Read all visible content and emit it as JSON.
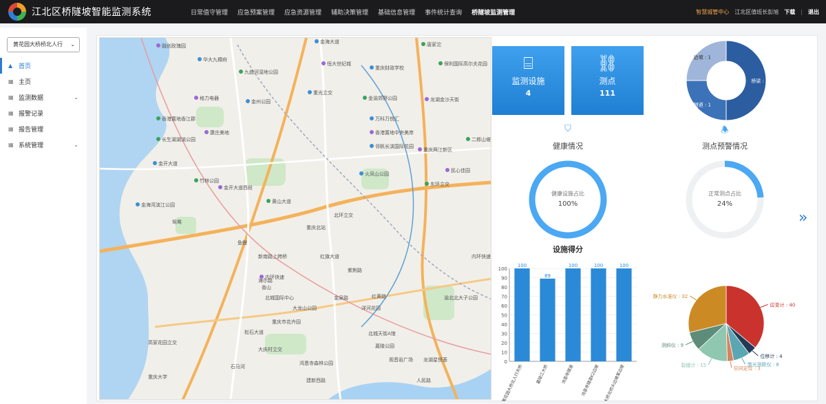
{
  "app": {
    "title": "江北区桥隧坡智能监测系统"
  },
  "nav": [
    "日常值守管理",
    "应急预案管理",
    "应急资源管理",
    "辅助决策管理",
    "基础信息管理",
    "事件统计查询",
    "桥隧坡监测管理"
  ],
  "top_right": {
    "highlight": "智慧城管中心",
    "user": "江北区值班长彭旭",
    "download": "下载",
    "logout": "退出"
  },
  "sidebar": {
    "select_value": "黄花园大桥桥北人行",
    "items": [
      {
        "label": "首页",
        "icon": "home-icon",
        "active": true
      },
      {
        "label": "主页",
        "icon": "grid-icon"
      },
      {
        "label": "监测数据",
        "icon": "grid-icon",
        "expandable": true
      },
      {
        "label": "报警记录",
        "icon": "grid-icon"
      },
      {
        "label": "报告管理",
        "icon": "grid-icon"
      },
      {
        "label": "系统管理",
        "icon": "grid-icon",
        "expandable": true
      }
    ]
  },
  "map": {
    "labels": [
      "金海大道",
      "唐家沱",
      "融创玫瑰园",
      "华大九樽府",
      "九曲河湿地公园",
      "恒大世纪城",
      "重庆财政学校",
      "保利国际高尔夫花园",
      "格力电器",
      "重光立交",
      "金渝郊野公园",
      "龙湖金沙天街",
      "金州公园",
      "香港置地香江郡",
      "康庄美地",
      "万科万悦汇",
      "长生湖湖滨公园",
      "香港置地中央美岸",
      "邻帆长滨国际花园",
      "二郎山坡",
      "重庆两江新区",
      "金开大道",
      "竹林公园",
      "金开大道西段",
      "金海湾滨江公园",
      "黄山大道",
      "民心佳园",
      "火凤山公园",
      "东环立交",
      "内环快速",
      "北环立交",
      "鸳鸯",
      "鱼鲤",
      "新南路上跨桥",
      "红旗大道",
      "紫荆路",
      "重庆北站",
      "内环快速",
      "海尔路",
      "香山",
      "北城国际中心",
      "大龙山公园",
      "金泉路",
      "重庆市花卉园",
      "红黄路",
      "洋河花园",
      "渝北北大子公园",
      "松石大道",
      "大庆村立交",
      "北城天街A馆",
      "高家花园立交",
      "嘉陵公园",
      "龙湖星悦荟",
      "观音岩广场",
      "鸿恩寺森林公园",
      "石马河",
      "建新西路",
      "重庆大学",
      "人民路"
    ],
    "roads": [
      "内环快速",
      "金开大道",
      "黄山大道"
    ]
  },
  "tiles": [
    {
      "label": "监测设施",
      "value": "4",
      "icon": "bridge-icon"
    },
    {
      "label": "测点",
      "value": "111",
      "icon": "network-icon"
    }
  ],
  "donut_top": {
    "segments": [
      {
        "name": "桥梁",
        "value": 2,
        "color": "#2b5da0"
      },
      {
        "name": "隧道",
        "value": 1,
        "color": "#3c72b8"
      },
      {
        "name": "边坡",
        "value": 1,
        "color": "#9fb5d9"
      }
    ]
  },
  "health": {
    "title": "健康情况",
    "inner_label": "健康设施占比",
    "percent": "100%",
    "fraction": 1.0
  },
  "warning": {
    "title": "测点预警情况",
    "inner_label": "正常测点占比",
    "percent": "24%",
    "fraction": 0.24
  },
  "chart_data": [
    {
      "type": "bar",
      "title": "设施得分",
      "categories": [
        "黄花园大桥北人行天桥",
        "嘉陵江大桥",
        "鸿恩寺隧道",
        "鸿恩寺隧道K2边坡",
        "石门大桥北桥头边坡某边坡"
      ],
      "values": [
        100,
        89,
        100,
        100,
        100
      ],
      "ylim": [
        0,
        100
      ],
      "yticks": [
        0,
        10,
        20,
        30,
        40,
        50,
        60,
        70,
        80,
        90,
        100
      ],
      "color": "#2b8ad8"
    },
    {
      "type": "pie",
      "slices": [
        {
          "name": "应变计",
          "value": 40,
          "color": "#c9322d"
        },
        {
          "name": "位移计",
          "value": 4,
          "color": "#223a56"
        },
        {
          "name": "激光测距仪",
          "value": 8,
          "color": "#5aa7b3"
        },
        {
          "name": "空间定位",
          "value": 3,
          "color": "#d8835e"
        },
        {
          "name": "裂缝计",
          "value": 15,
          "color": "#8fc7b1"
        },
        {
          "name": "测斜仪",
          "value": 9,
          "color": "#5e8c7a"
        },
        {
          "name": "静力水准仪",
          "value": 32,
          "color": "#cc8a24"
        }
      ]
    }
  ]
}
